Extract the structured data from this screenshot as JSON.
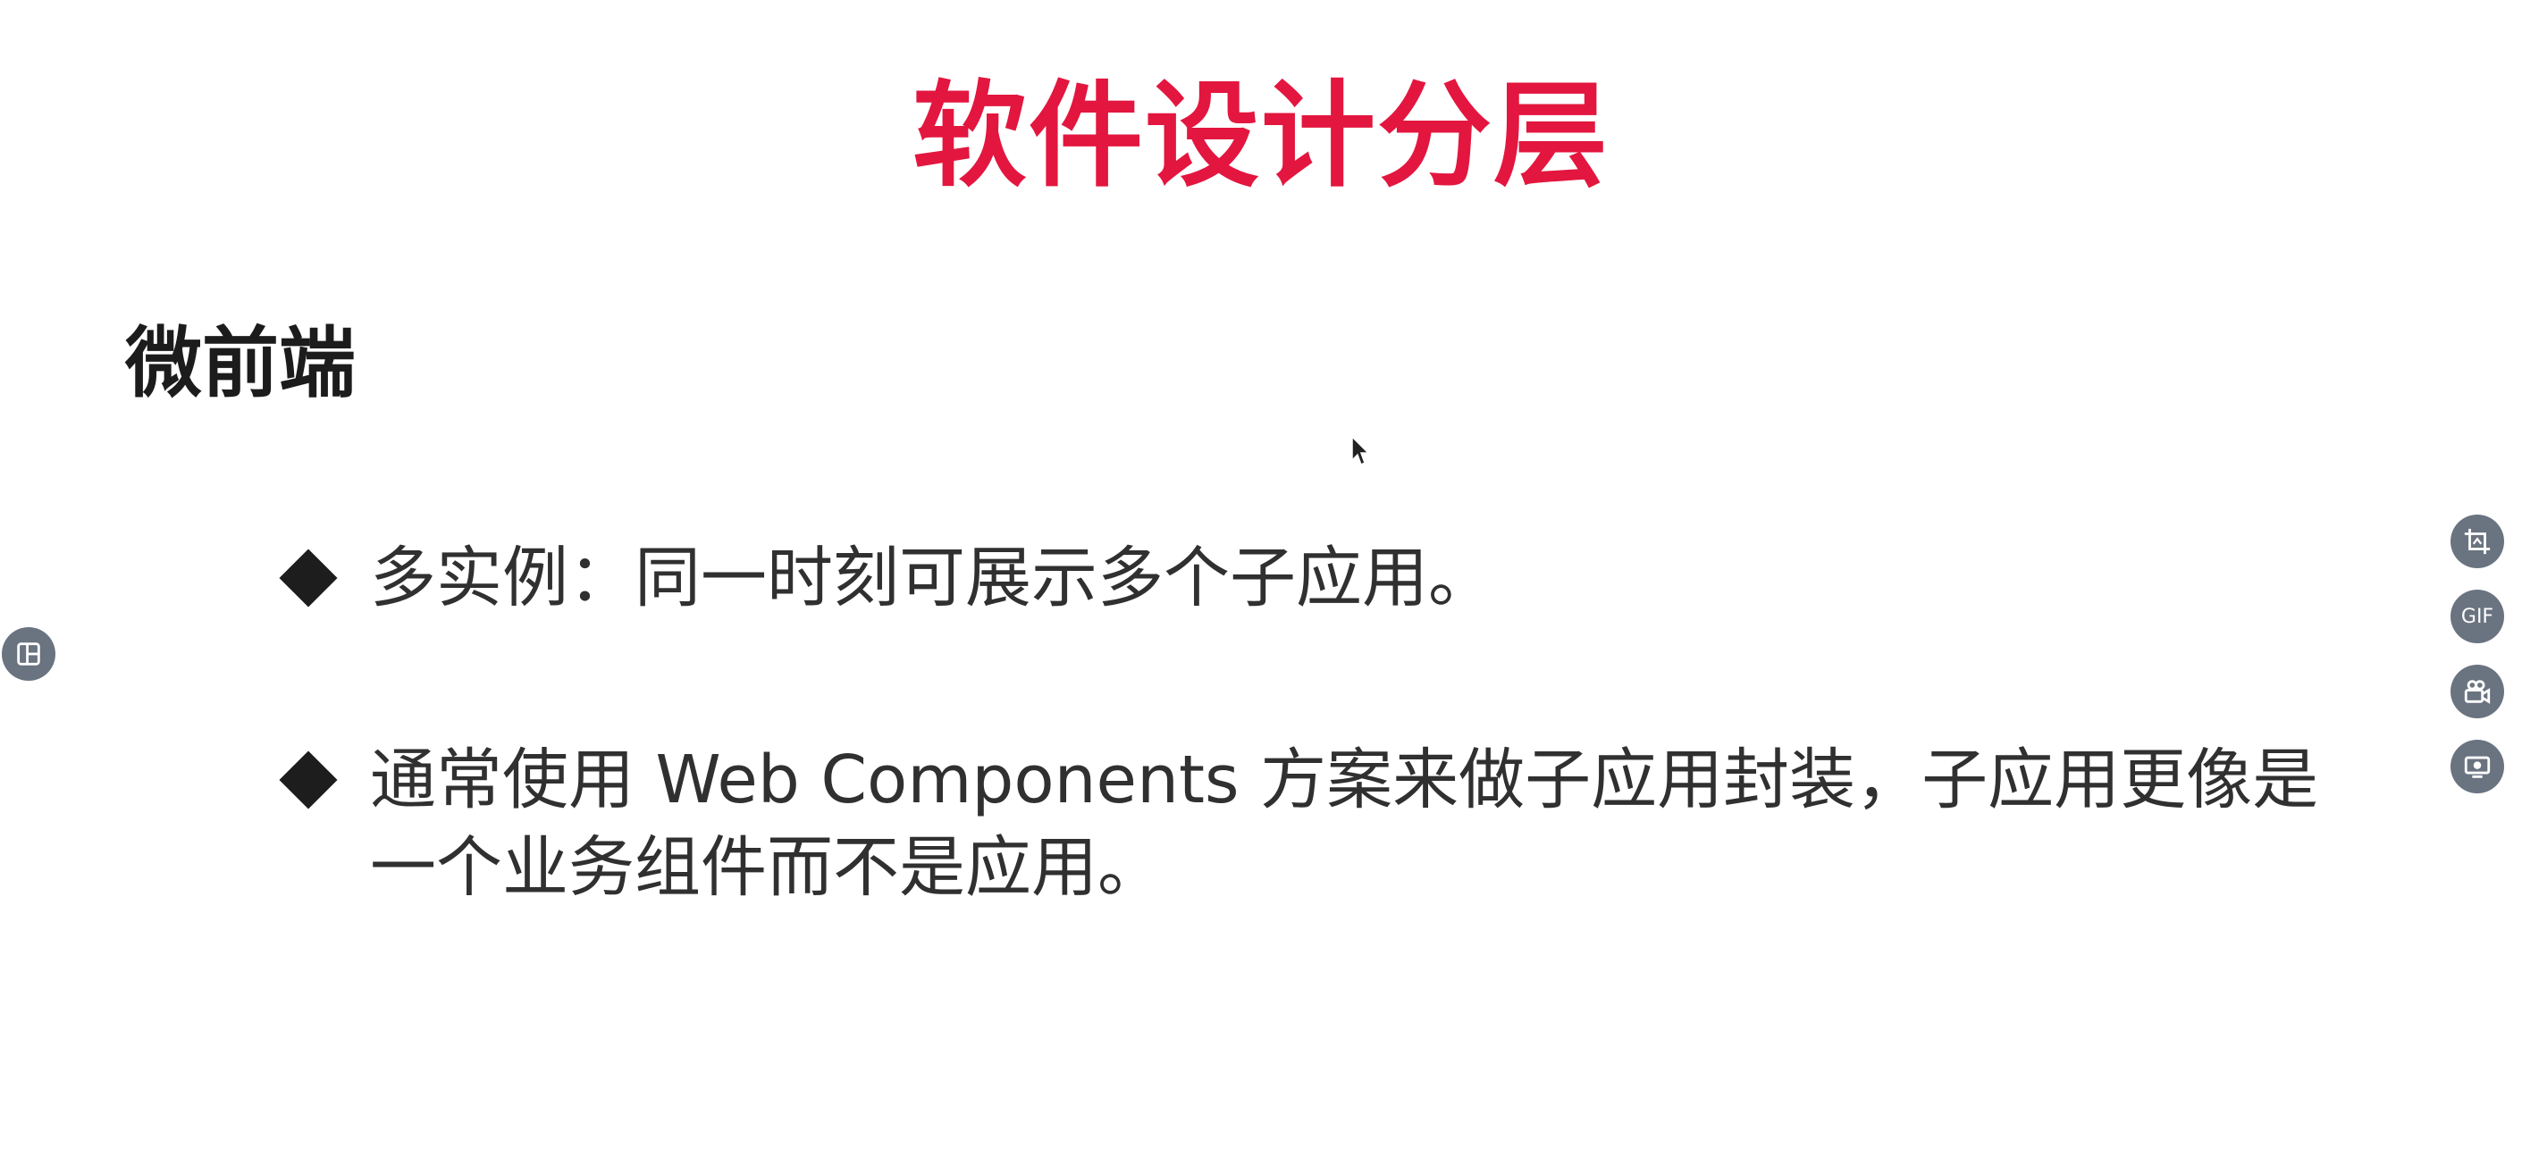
{
  "slide": {
    "title": "软件设计分层",
    "subtitle": "微前端",
    "bullets": [
      {
        "line1": "多实例：同一时刻可展示多个子应用。"
      },
      {
        "line1": "通常使用 Web Components 方案来做子应用封装，子应用更像是",
        "line2": "一个业务组件而不是应用。"
      }
    ]
  },
  "toolbar": {
    "left_button_icon": "layout-panel-icon",
    "right_buttons": [
      {
        "icon": "crop-screenshot-icon"
      },
      {
        "label": "GIF"
      },
      {
        "icon": "video-camera-icon"
      },
      {
        "icon": "screen-record-icon"
      }
    ]
  },
  "colors": {
    "title": "#e3163f",
    "text": "#303030",
    "buttons": "#6a7380"
  }
}
